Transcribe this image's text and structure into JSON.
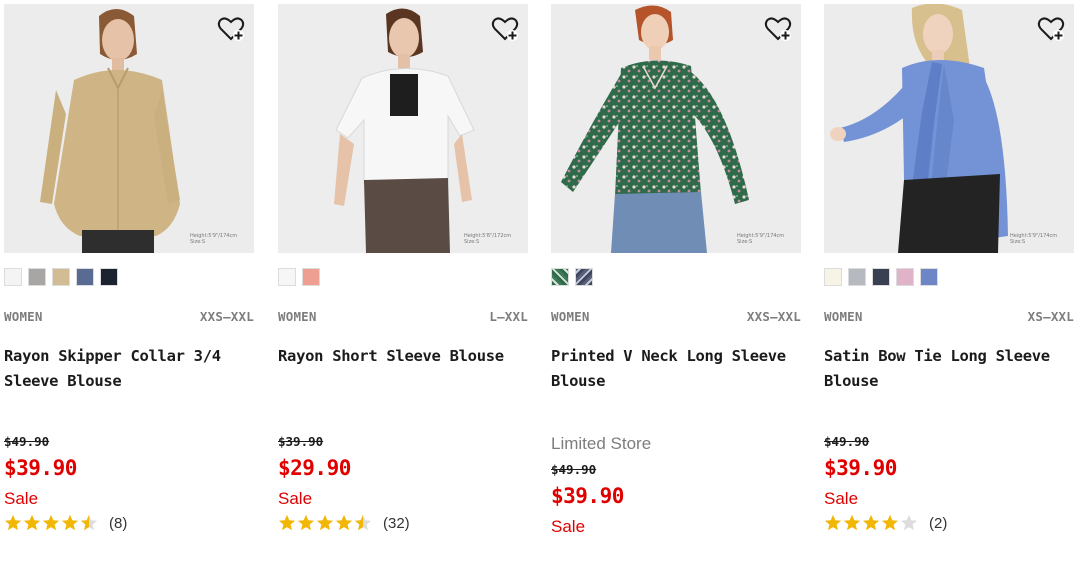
{
  "colors": {
    "sale_red": "#e00000",
    "star_gold": "#f2b705",
    "meta_gray": "#7d7d7d"
  },
  "products": [
    {
      "category": "WOMEN",
      "sizes": "XXS–XXL",
      "name": "Rayon Skipper Collar 3/4 Sleeve Blouse",
      "store": "",
      "original_price": "$49.90",
      "price": "$39.90",
      "sale_label": "Sale",
      "rating": 4.5,
      "review_count": "(8)",
      "model_tag": "Height:5'9\"/174cm\nSize:S",
      "wishlist_icon": "heart-plus-icon",
      "swatches": [
        "#f4f4f4",
        "#a8a6a4",
        "#d2bc94",
        "#5a6b93",
        "#1c2230"
      ]
    },
    {
      "category": "WOMEN",
      "sizes": "L–XXL",
      "name": "Rayon Short Sleeve Blouse",
      "store": "",
      "original_price": "$39.90",
      "price": "$29.90",
      "sale_label": "Sale",
      "rating": 4.5,
      "review_count": "(32)",
      "model_tag": "Height:5'8\"/172cm\nSize:S",
      "wishlist_icon": "heart-plus-icon",
      "swatches": [
        "#f6f6f6",
        "#ee9f92"
      ]
    },
    {
      "category": "WOMEN",
      "sizes": "XXS–XXL",
      "name": "Printed V Neck Long Sleeve Blouse",
      "store": "Limited Store",
      "original_price": "$49.90",
      "price": "$39.90",
      "sale_label": "Sale",
      "rating": null,
      "review_count": "",
      "model_tag": "Height:5'9\"/174cm\nSize:S",
      "wishlist_icon": "heart-plus-icon",
      "swatches": [
        "#3e7a5a",
        "#58607a"
      ]
    },
    {
      "category": "WOMEN",
      "sizes": "XS–XXL",
      "name": "Satin Bow Tie Long Sleeve Blouse",
      "store": "",
      "original_price": "$49.90",
      "price": "$39.90",
      "sale_label": "Sale",
      "rating": 4,
      "review_count": "(2)",
      "model_tag": "Height:5'9\"/174cm\nSize:S",
      "wishlist_icon": "heart-plus-icon",
      "swatches": [
        "#f7f4e6",
        "#b7b9c0",
        "#384052",
        "#e1b3c9",
        "#6f86c6"
      ]
    }
  ]
}
